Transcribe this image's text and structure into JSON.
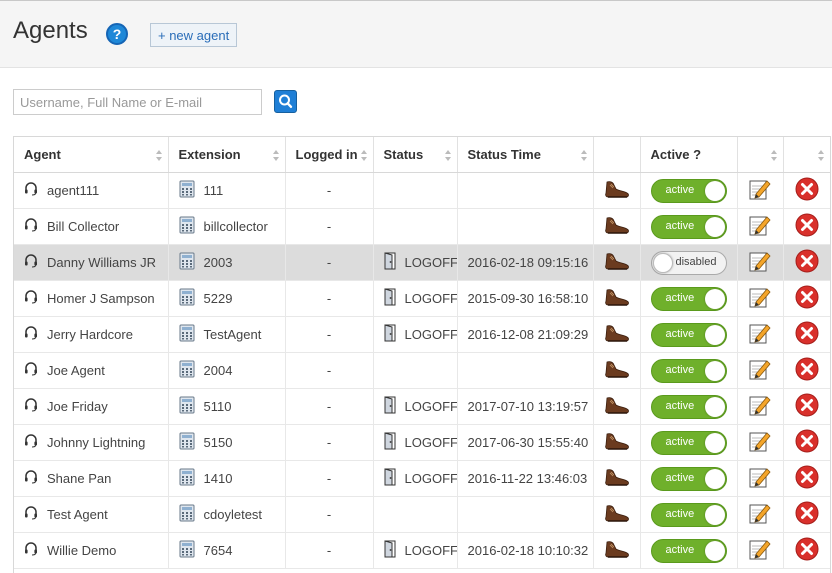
{
  "header": {
    "title": "Agents",
    "help_icon": "?",
    "new_agent_label": "+ new agent"
  },
  "search": {
    "placeholder": "Username, Full Name or E-mail"
  },
  "table": {
    "columns": [
      "Agent",
      "Extension",
      "Logged in",
      "Status",
      "Status Time",
      "",
      "Active ?",
      "",
      ""
    ],
    "rows": [
      {
        "agent": "agent111",
        "extension": "111",
        "logged_in": "-",
        "status": "",
        "status_time": "",
        "active": "active",
        "highlight": false
      },
      {
        "agent": "Bill Collector",
        "extension": "billcollector",
        "logged_in": "-",
        "status": "",
        "status_time": "",
        "active": "active",
        "highlight": false
      },
      {
        "agent": "Danny Williams JR",
        "extension": "2003",
        "logged_in": "-",
        "status": "LOGOFF",
        "status_time": "2016-02-18 09:15:16",
        "active": "disabled",
        "highlight": true
      },
      {
        "agent": "Homer J Sampson",
        "extension": "5229",
        "logged_in": "-",
        "status": "LOGOFF",
        "status_time": "2015-09-30 16:58:10",
        "active": "active",
        "highlight": false
      },
      {
        "agent": "Jerry Hardcore",
        "extension": "TestAgent",
        "logged_in": "-",
        "status": "LOGOFF",
        "status_time": "2016-12-08 21:09:29",
        "active": "active",
        "highlight": false
      },
      {
        "agent": "Joe Agent",
        "extension": "2004",
        "logged_in": "-",
        "status": "",
        "status_time": "",
        "active": "active",
        "highlight": false
      },
      {
        "agent": "Joe Friday",
        "extension": "5110",
        "logged_in": "-",
        "status": "LOGOFF",
        "status_time": "2017-07-10 13:19:57",
        "active": "active",
        "highlight": false
      },
      {
        "agent": "Johnny Lightning",
        "extension": "5150",
        "logged_in": "-",
        "status": "LOGOFF",
        "status_time": "2017-06-30 15:55:40",
        "active": "active",
        "highlight": false
      },
      {
        "agent": "Shane Pan",
        "extension": "1410",
        "logged_in": "-",
        "status": "LOGOFF",
        "status_time": "2016-11-22 13:46:03",
        "active": "active",
        "highlight": false
      },
      {
        "agent": "Test Agent",
        "extension": "cdoyletest",
        "logged_in": "-",
        "status": "",
        "status_time": "",
        "active": "active",
        "highlight": false
      },
      {
        "agent": "Willie Demo",
        "extension": "7654",
        "logged_in": "-",
        "status": "LOGOFF",
        "status_time": "2016-02-18 10:10:32",
        "active": "active",
        "highlight": false
      }
    ]
  },
  "icons": {
    "row_icons": [
      "headset-icon",
      "phone-icon",
      "door-icon",
      "shoe-icon",
      "edit-icon",
      "delete-icon"
    ],
    "search": "magnifier-icon"
  },
  "colors": {
    "accent": "#1f7fd6",
    "toggle_on": "#6fb02b",
    "delete": "#d9302b",
    "highlight_row": "#dcdcdc"
  }
}
